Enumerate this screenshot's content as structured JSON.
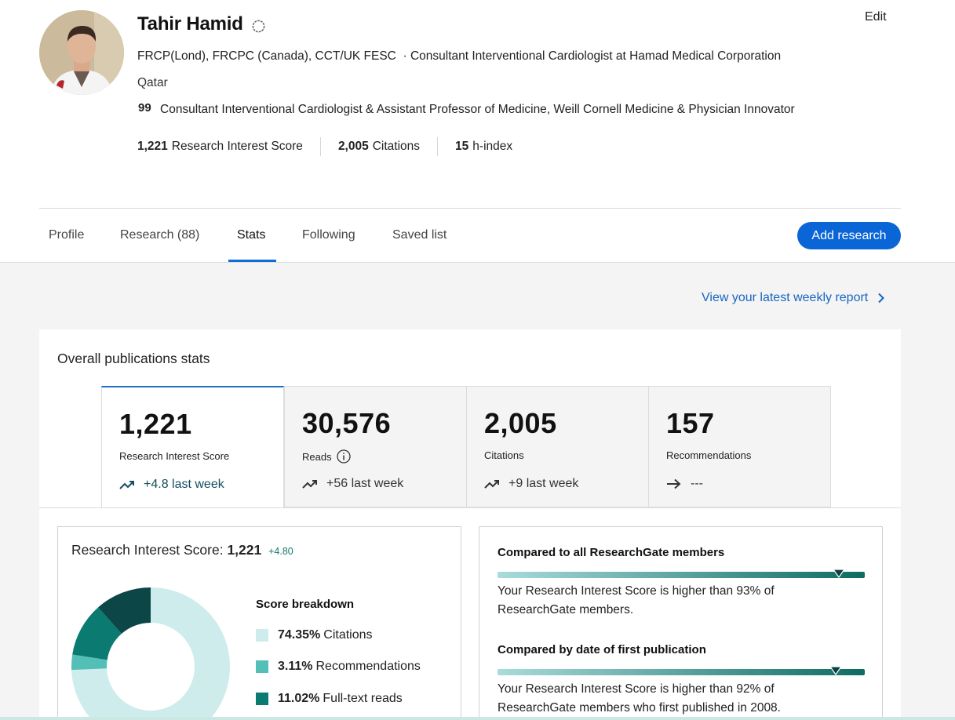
{
  "profile": {
    "name": "Tahir Hamid",
    "edit_label": "Edit",
    "degrees_line": "FRCP(Lond), FRCPC (Canada), CCT/UK FESC  · Consultant Interventional Cardiologist at Hamad Medical Corporation",
    "country": "Qatar",
    "quote_glyph": "99",
    "headline": "Consultant Interventional Cardiologist & Assistant Professor of Medicine, Weill Cornell Medicine & Physician Innovator",
    "metrics": [
      {
        "value": "1,221",
        "label": "Research Interest Score"
      },
      {
        "value": "2,005",
        "label": "Citations"
      },
      {
        "value": "15",
        "label": "h-index"
      }
    ]
  },
  "tabs": [
    {
      "label": "Profile",
      "active": false
    },
    {
      "label": "Research (88)",
      "active": false
    },
    {
      "label": "Stats",
      "active": true
    },
    {
      "label": "Following",
      "active": false
    },
    {
      "label": "Saved list",
      "active": false
    }
  ],
  "add_research_label": "Add research",
  "weekly_report_label": "View your latest weekly report",
  "overall": {
    "title": "Overall publications stats",
    "stats": [
      {
        "value": "1,221",
        "label": "Research Interest Score",
        "trend": "+4.8 last week",
        "trend_icon": "trending-up-icon",
        "active": true
      },
      {
        "value": "30,576",
        "label": "Reads",
        "trend": "+56 last week",
        "trend_icon": "trending-up-icon",
        "active": false
      },
      {
        "value": "2,005",
        "label": "Citations",
        "trend": "+9 last week",
        "trend_icon": "trending-up-icon",
        "active": false
      },
      {
        "value": "157",
        "label": "Recommendations",
        "trend": "---",
        "trend_icon": "arrow-right-icon",
        "active": false
      }
    ]
  },
  "ris_panel": {
    "title_prefix": "Research Interest Score:",
    "value": "1,221",
    "delta": "+4.80",
    "breakdown_title": "Score breakdown",
    "breakdown": [
      {
        "percent": "74.35%",
        "label": "Citations",
        "color": "#cdeceb"
      },
      {
        "percent": "3.11%",
        "label": "Recommendations",
        "color": "#54bfb6"
      },
      {
        "percent": "11.02%",
        "label": "Full-text reads",
        "color": "#0b7b72"
      }
    ],
    "donut_segments": [
      {
        "share": 0.7435,
        "color": "#cdeceb"
      },
      {
        "share": 0.0311,
        "color": "#54bfb6"
      },
      {
        "share": 0.1102,
        "color": "#0b7b72"
      },
      {
        "share": 0.1152,
        "color": "#0c4647"
      }
    ]
  },
  "compare_panel": {
    "items": [
      {
        "title": "Compared to all ResearchGate members",
        "percentile": 0.93,
        "text_line1": "Your Research Interest Score is higher than 93% of",
        "text_line2": "ResearchGate members."
      },
      {
        "title": "Compared by date of first publication",
        "percentile": 0.92,
        "text_line1": "Your Research Interest Score is higher than 92% of",
        "text_line2": "ResearchGate members who first published in 2008."
      }
    ]
  },
  "colors": {
    "accent_blue": "#0a66d6",
    "link_blue": "#1765c1",
    "teal_dark": "#0d6b62",
    "teal_light": "#a9dcdc"
  }
}
